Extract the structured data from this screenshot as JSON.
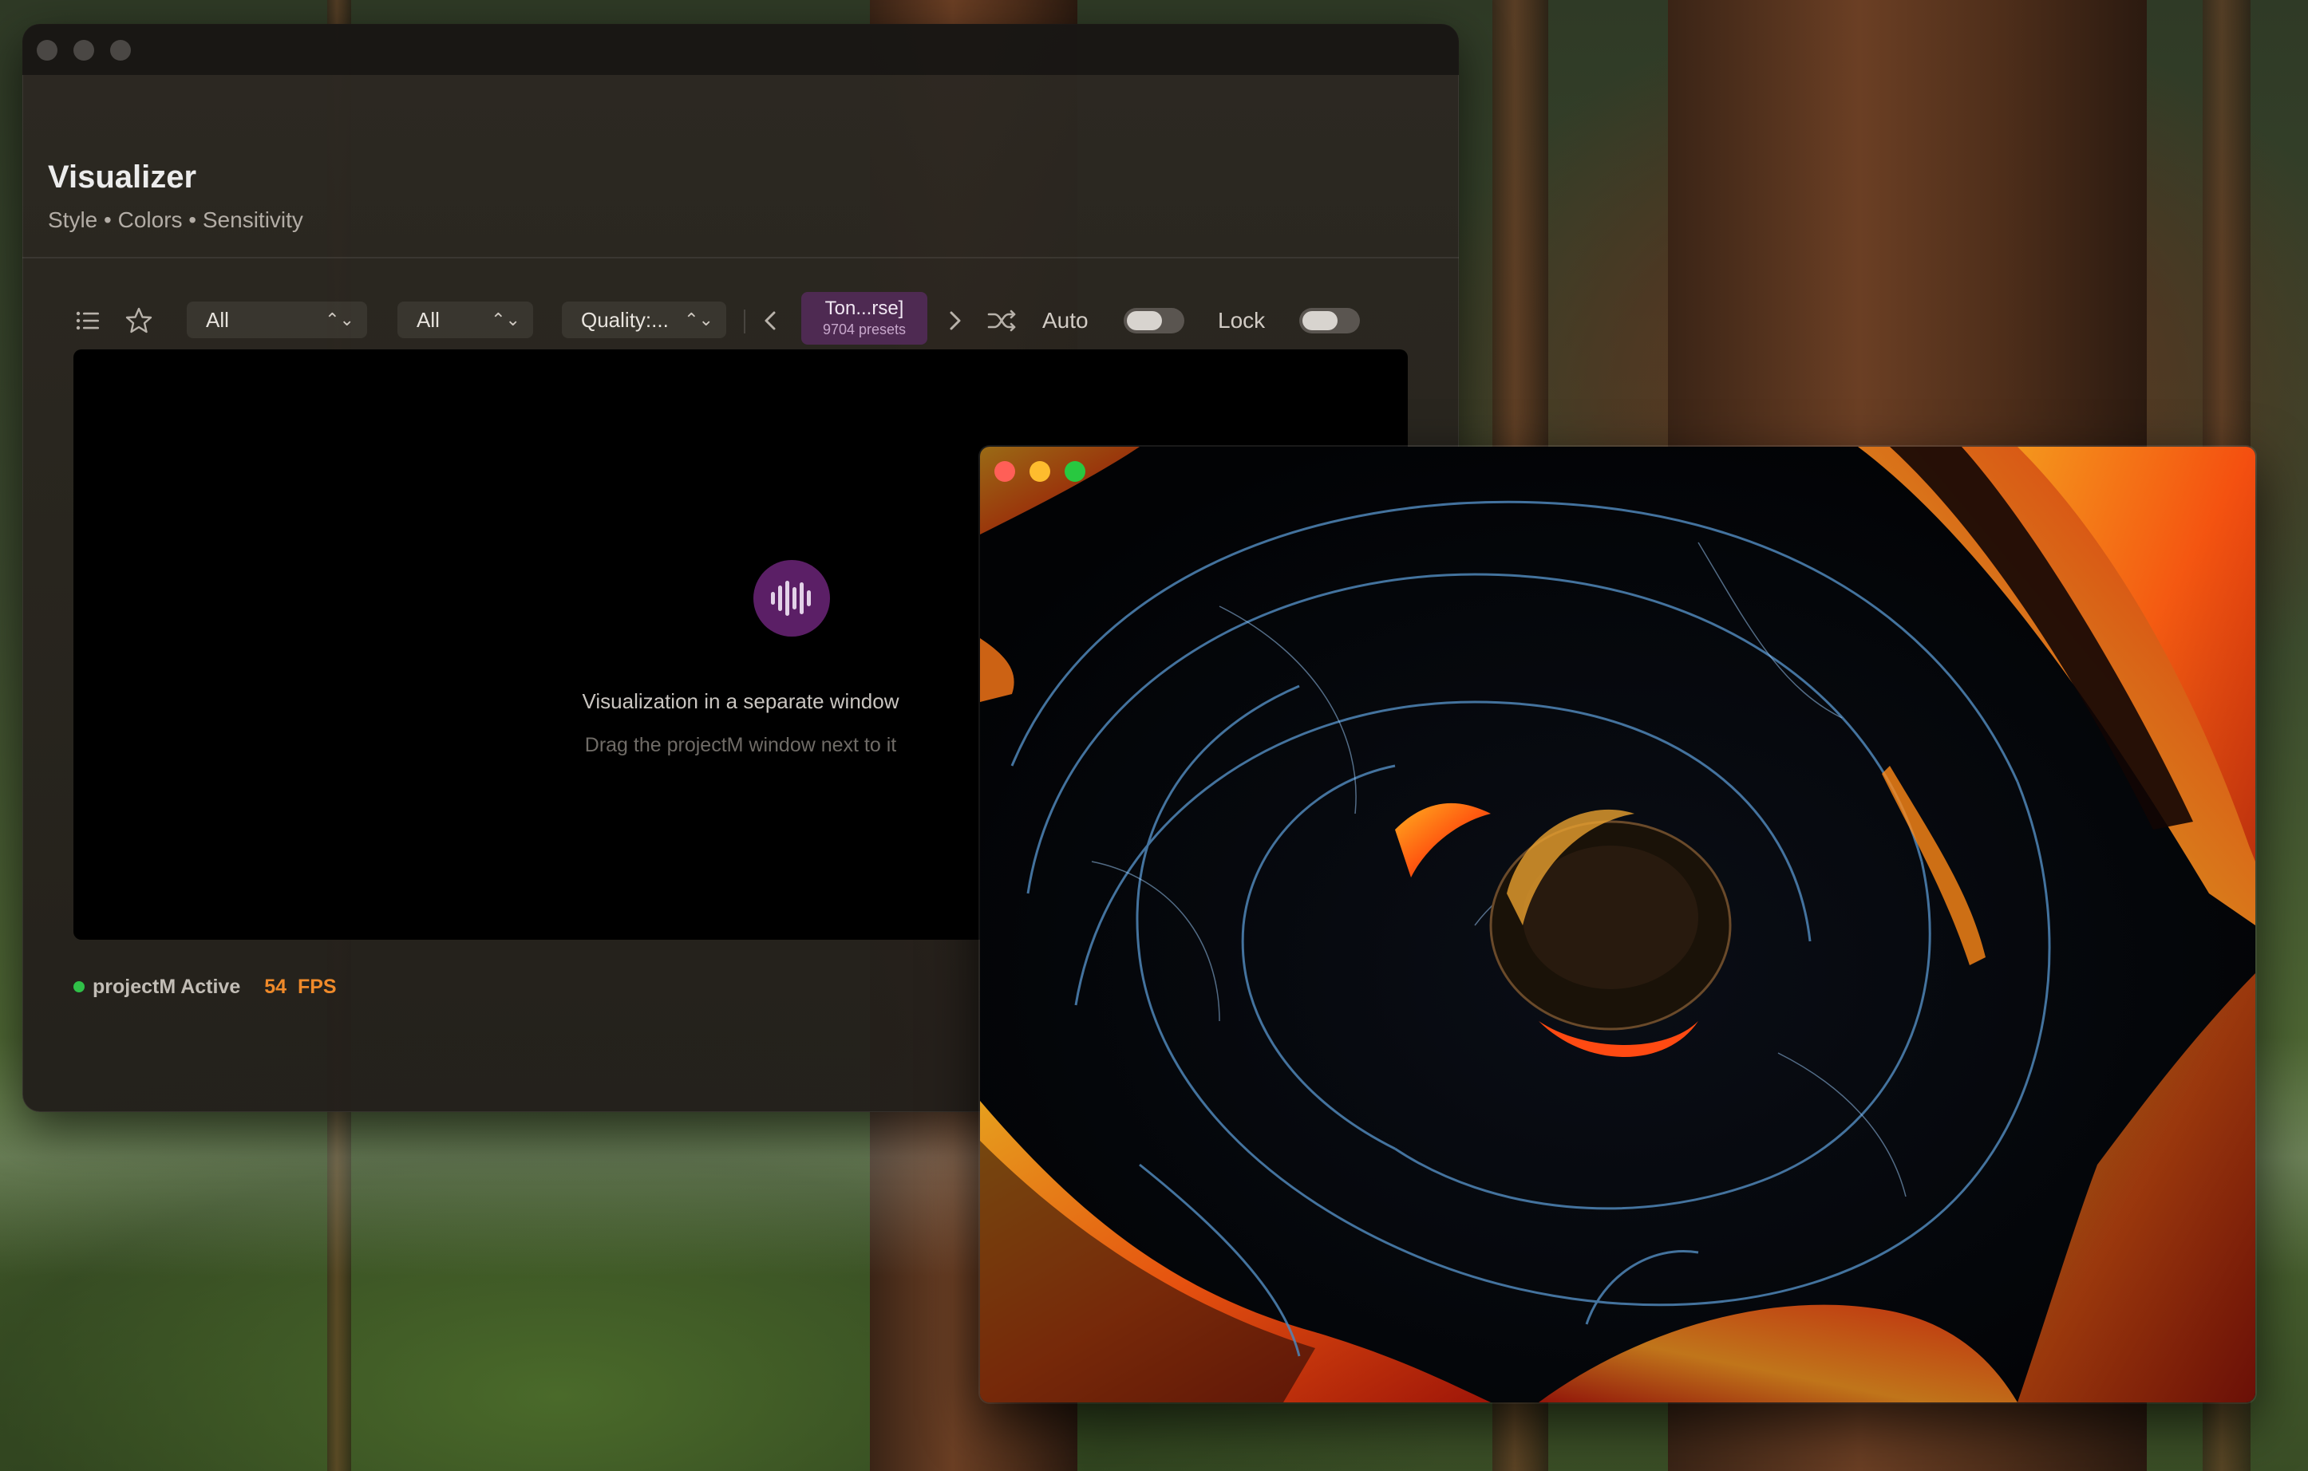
{
  "main_window": {
    "title": "Visualizer",
    "subtitle": "Style • Colors • Sensitivity",
    "toolbar": {
      "list_icon": "list-icon",
      "favorite_icon": "star-icon",
      "filter1": {
        "value": "All"
      },
      "filter2": {
        "value": "All"
      },
      "quality": {
        "value": "Quality:..."
      },
      "preset": {
        "name": "Ton...rse]",
        "count": "9704 presets"
      },
      "auto_label": "Auto",
      "lock_label": "Lock"
    },
    "viz_panel": {
      "message": "Visualization in a separate window",
      "hint": "Drag the projectM window next to it"
    },
    "status": {
      "text": "projectM Active",
      "fps_value": "54",
      "fps_unit": "FPS"
    }
  },
  "colors": {
    "accent_purple": "#5b1f66",
    "preset_bg": "#4e2a52",
    "status_green": "#30c048",
    "fps_orange": "#ef8a2a"
  }
}
